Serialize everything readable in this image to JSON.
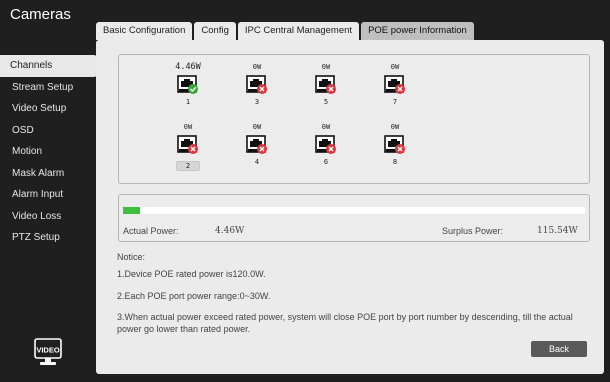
{
  "app": {
    "title": "Cameras"
  },
  "tabs": [
    {
      "label": "Basic Configuration"
    },
    {
      "label": "Config"
    },
    {
      "label": "IPC Central Management"
    },
    {
      "label": "POE power Information"
    }
  ],
  "sidebar": {
    "items": [
      {
        "label": "Channels"
      },
      {
        "label": "Stream Setup"
      },
      {
        "label": "Video Setup"
      },
      {
        "label": "OSD"
      },
      {
        "label": "Motion"
      },
      {
        "label": "Mask Alarm"
      },
      {
        "label": "Alarm Input"
      },
      {
        "label": "Video Loss"
      },
      {
        "label": "PTZ Setup"
      }
    ],
    "logo_text": "VIDEO"
  },
  "ports": [
    {
      "number": "1",
      "power": "4.46W",
      "status": "ok"
    },
    {
      "number": "3",
      "power": "0W",
      "status": "off"
    },
    {
      "number": "5",
      "power": "0W",
      "status": "off"
    },
    {
      "number": "7",
      "power": "0W",
      "status": "off"
    },
    {
      "number": "2",
      "power": "0W",
      "status": "off"
    },
    {
      "number": "4",
      "power": "0W",
      "status": "off"
    },
    {
      "number": "6",
      "power": "0W",
      "status": "off"
    },
    {
      "number": "8",
      "power": "0W",
      "status": "off"
    }
  ],
  "power": {
    "actual_label": "Actual Power:",
    "actual_value": "4.46W",
    "surplus_label": "Surplus Power:",
    "surplus_value": "115.54W",
    "usage_fraction": 0.037
  },
  "notice": {
    "heading": "Notice:",
    "line1": "1.Device POE rated power is120.0W.",
    "line2": "2.Each POE port power range:0~30W.",
    "line3": "3.When actual power exceed rated power, system will close POE port by port number by descending, till the actual power go lower than rated power."
  },
  "buttons": {
    "back": "Back"
  },
  "colors": {
    "ok": "#3aa63a",
    "off": "#d9363e",
    "bar": "#3fbf3f"
  }
}
